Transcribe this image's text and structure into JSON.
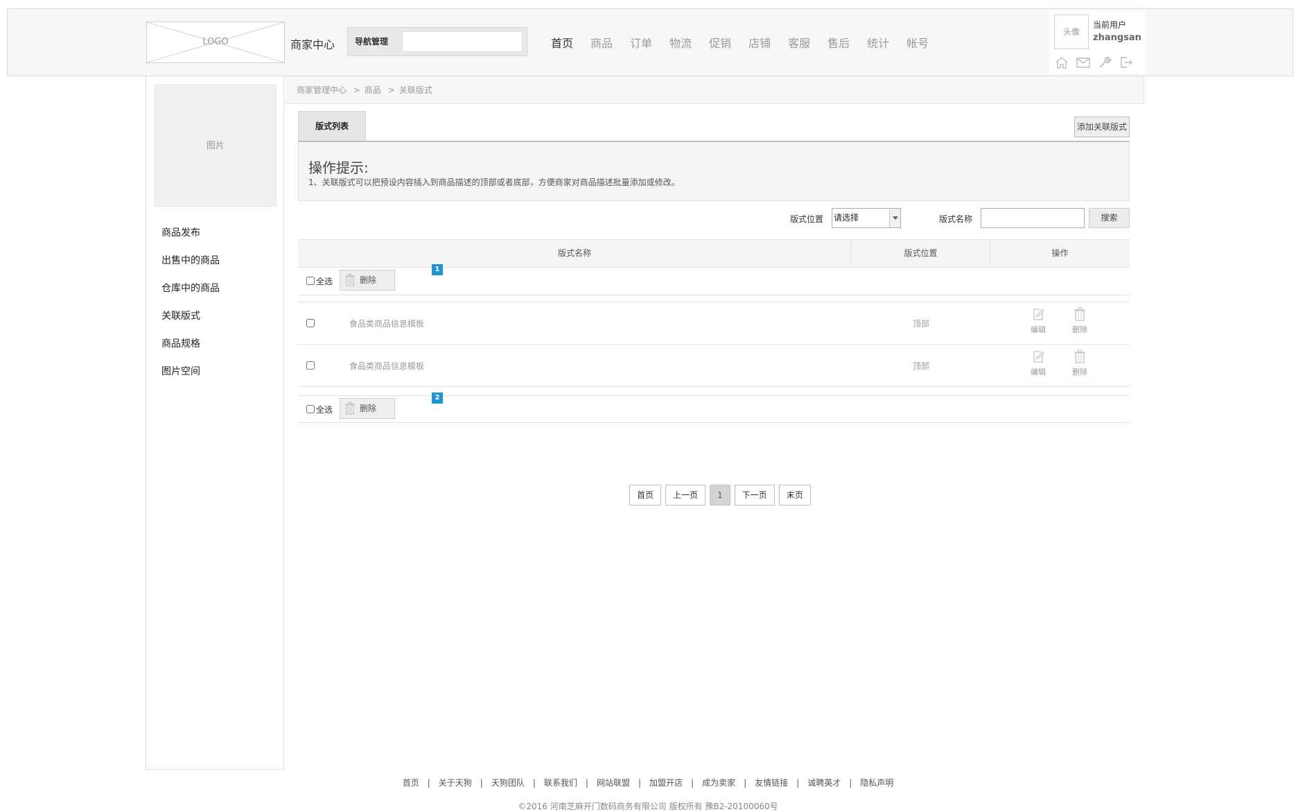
{
  "header": {
    "logo_text": "LOGO",
    "site_title": "商家中心",
    "nav_search_label": "导航管理",
    "nav_items": [
      "首页",
      "商品",
      "订单",
      "物流",
      "促销",
      "店铺",
      "客服",
      "售后",
      "统计",
      "帐号"
    ],
    "active_nav": "首页",
    "user": {
      "avatar_text": "头像",
      "label": "当前用户",
      "name": "zhangsan",
      "icons": [
        "home-icon",
        "mail-icon",
        "wrench-icon",
        "logout-icon"
      ]
    }
  },
  "sidebar": {
    "image_text": "图片",
    "items": [
      "商品发布",
      "出售中的商品",
      "仓库中的商品",
      "关联版式",
      "商品规格",
      "图片空间"
    ]
  },
  "breadcrumb": [
    "商家管理中心",
    "商品",
    "关联版式"
  ],
  "breadcrumb_separator": ">",
  "tabs": {
    "active": "版式列表",
    "add_button": "添加关联版式"
  },
  "tips": {
    "title": "操作提示:",
    "text": "1、关联版式可以把预设内容插入到商品描述的顶部或者底部，方便商家对商品描述批量添加或修改。"
  },
  "filter": {
    "position_label": "版式位置",
    "position_value": "请选择",
    "name_label": "版式名称",
    "name_value": "",
    "search_button": "搜索"
  },
  "table": {
    "headers": [
      "版式名称",
      "版式位置",
      "操作"
    ],
    "select_all_label": "全选",
    "delete_label": "删除",
    "top_badge": "1",
    "bottom_badge": "2",
    "rows": [
      {
        "name": "食品类商品信息模板",
        "position": "顶部",
        "edit": "编辑",
        "delete": "删除"
      },
      {
        "name": "食品类商品信息模板",
        "position": "顶部",
        "edit": "编辑",
        "delete": "删除"
      }
    ]
  },
  "pagination": {
    "first": "首页",
    "prev": "上一页",
    "current": "1",
    "next": "下一页",
    "last": "末页"
  },
  "footer": {
    "links": [
      "首页",
      "关于天狗",
      "天狗团队",
      "联系我们",
      "网站联盟",
      "加盟开店",
      "成为卖家",
      "友情链接",
      "诚聘英才",
      "隐私声明"
    ],
    "separator": "|",
    "copyright": "©2016 河南芝麻开门数码商务有限公司 版权所有 豫B2-20100060号"
  },
  "colors": {
    "badge": "#1e95d4",
    "header_bg": "#f7f7f7",
    "active_nav": "#333333",
    "inactive_nav": "#9a9a9a"
  }
}
